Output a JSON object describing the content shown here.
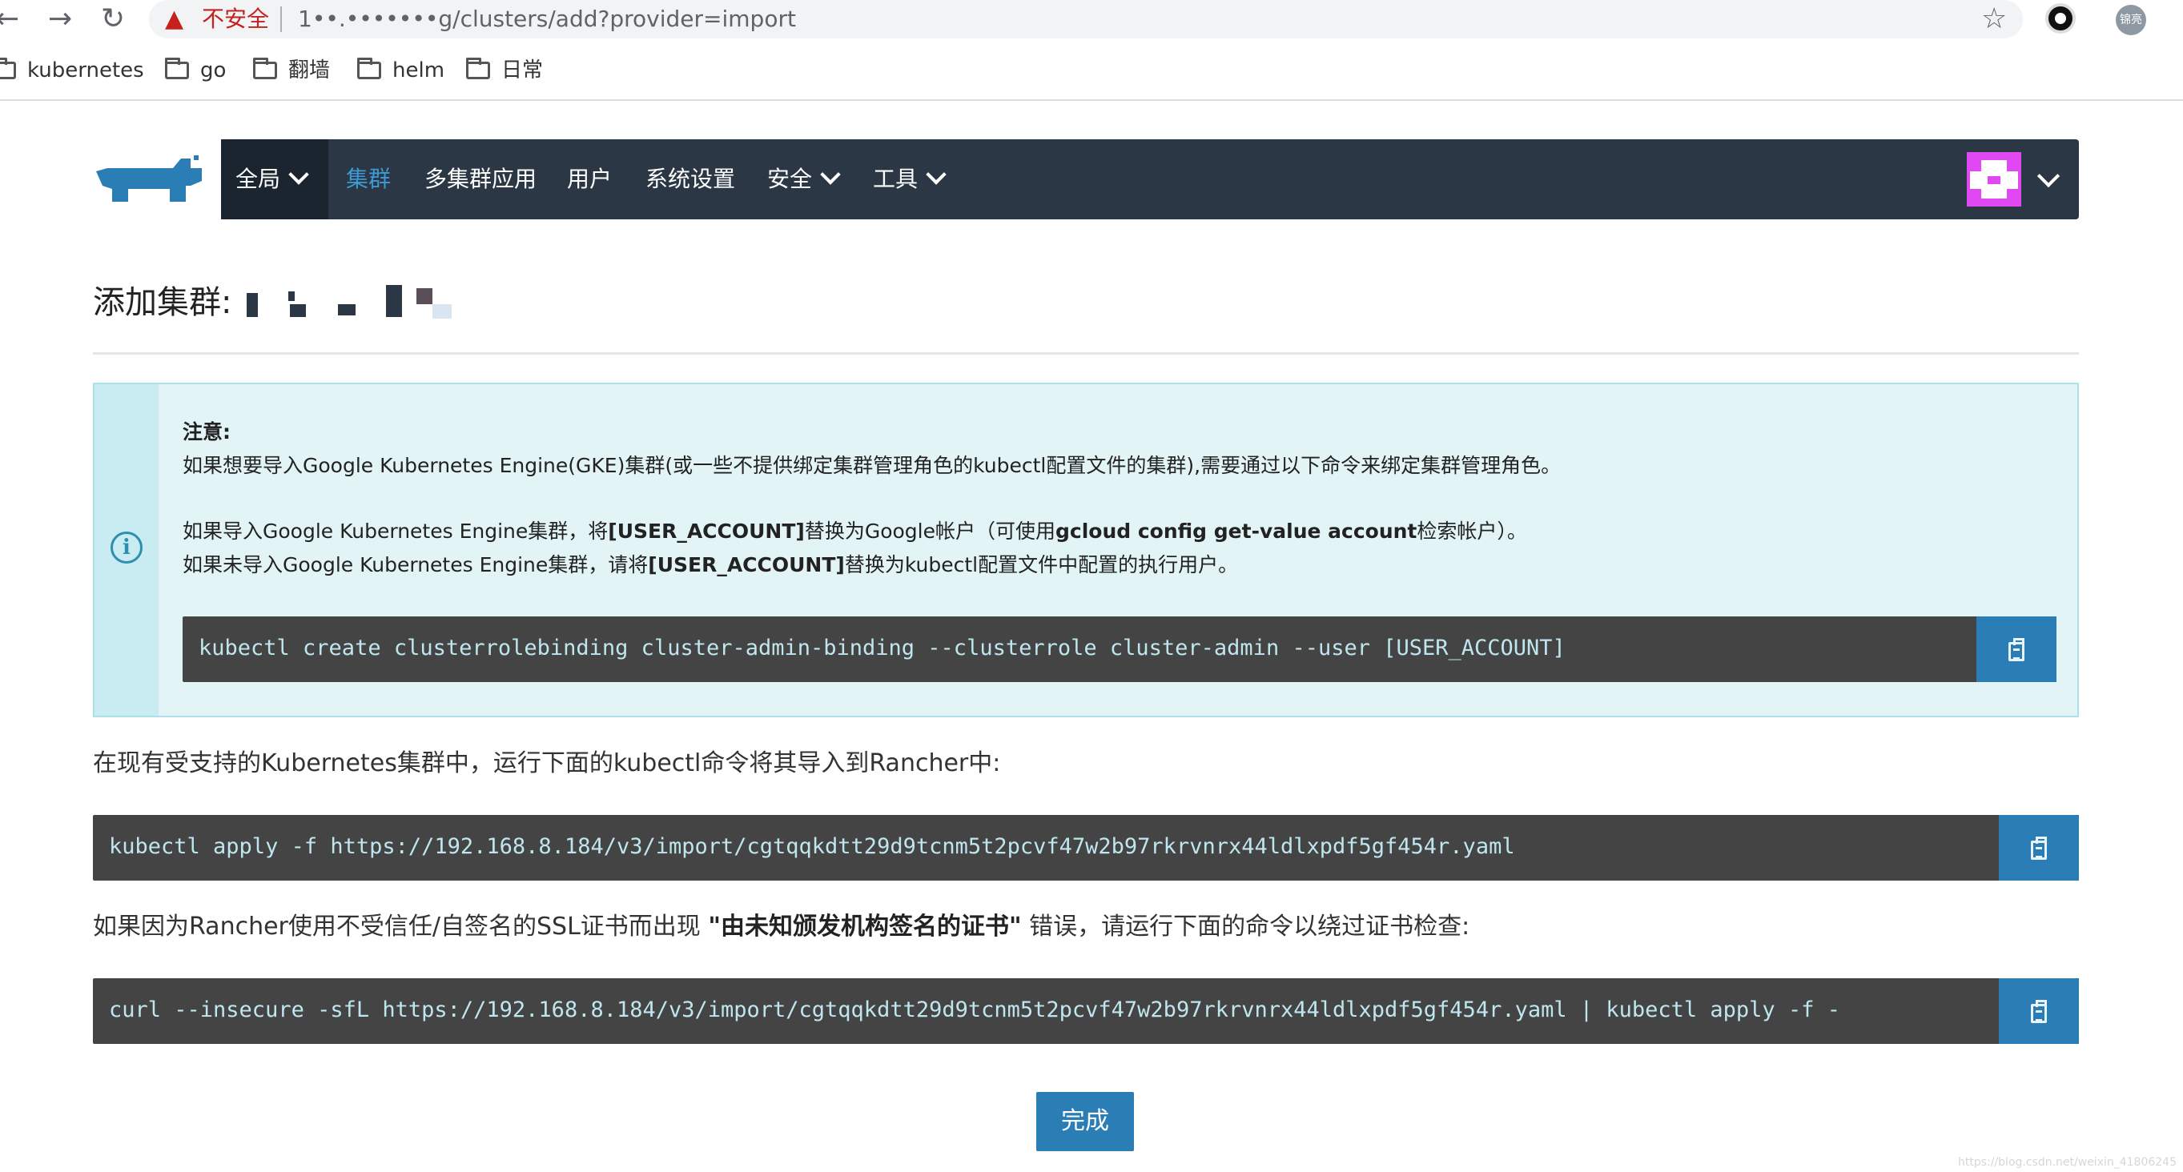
{
  "browser": {
    "insecure_label": "不安全",
    "url": "1••.•••••••g/clusters/add?provider=import",
    "profile_label": "锦亮",
    "bookmarks": [
      "kubernetes",
      "go",
      "翻墙",
      "helm",
      "日常"
    ]
  },
  "nav": {
    "global": "全局",
    "clusters": "集群",
    "multi_cluster_apps": "多集群应用",
    "users": "用户",
    "settings": "系统设置",
    "security": "安全",
    "tools": "工具"
  },
  "page": {
    "title": "添加集群:",
    "note": {
      "heading": "注意:",
      "line1": "如果想要导入Google Kubernetes Engine(GKE)集群(或一些不提供绑定集群管理角色的kubectl配置文件的集群),需要通过以下命令来绑定集群管理角色。",
      "line2_a": "如果导入Google Kubernetes Engine集群，将",
      "line2_b": "[USER_ACCOUNT]",
      "line2_c": "替换为Google帐户（可使用",
      "line2_d": "gcloud config get-value account",
      "line2_e": "检索帐户）。",
      "line3_a": "如果未导入Google Kubernetes Engine集群，请将",
      "line3_b": "[USER_ACCOUNT]",
      "line3_c": "替换为kubectl配置文件中配置的执行用户。",
      "command": "kubectl create clusterrolebinding cluster-admin-binding --clusterrole cluster-admin --user [USER_ACCOUNT]"
    },
    "import_text": "在现有受支持的Kubernetes集群中，运行下面的kubectl命令将其导入到Rancher中:",
    "import_command": "kubectl apply -f https://192.168.8.184/v3/import/cgtqqkdtt29d9tcnm5t2pcvf47w2b97rkrvnrx44ldlxpdf5gf454r.yaml",
    "ssl_text_a": "如果因为Rancher使用不受信任/自签名的SSL证书而出现 ",
    "ssl_text_b": "\"由未知颁发机构签名的证书\"",
    "ssl_text_c": " 错误，请运行下面的命令以绕过证书检查:",
    "curl_command": "curl --insecure -sfL https://192.168.8.184/v3/import/cgtqqkdtt29d9tcnm5t2pcvf47w2b97rkrvnrx44ldlxpdf5gf454r.yaml | kubectl apply -f -",
    "done_label": "完成"
  },
  "watermark": "https://blog.csdn.net/weixin_41806245",
  "icons": [
    "back-icon",
    "forward-icon",
    "reload-icon",
    "warning-icon",
    "star-icon",
    "extension-icon",
    "folder-icon",
    "rancher-logo",
    "chevron-down-icon",
    "info-icon",
    "copy-icon"
  ],
  "colors": {
    "navbar": "#2b3744",
    "accent": "#3d98d3",
    "button": "#2a7eb5",
    "code_bg": "#444444",
    "info_bg": "#e3f4f7"
  }
}
